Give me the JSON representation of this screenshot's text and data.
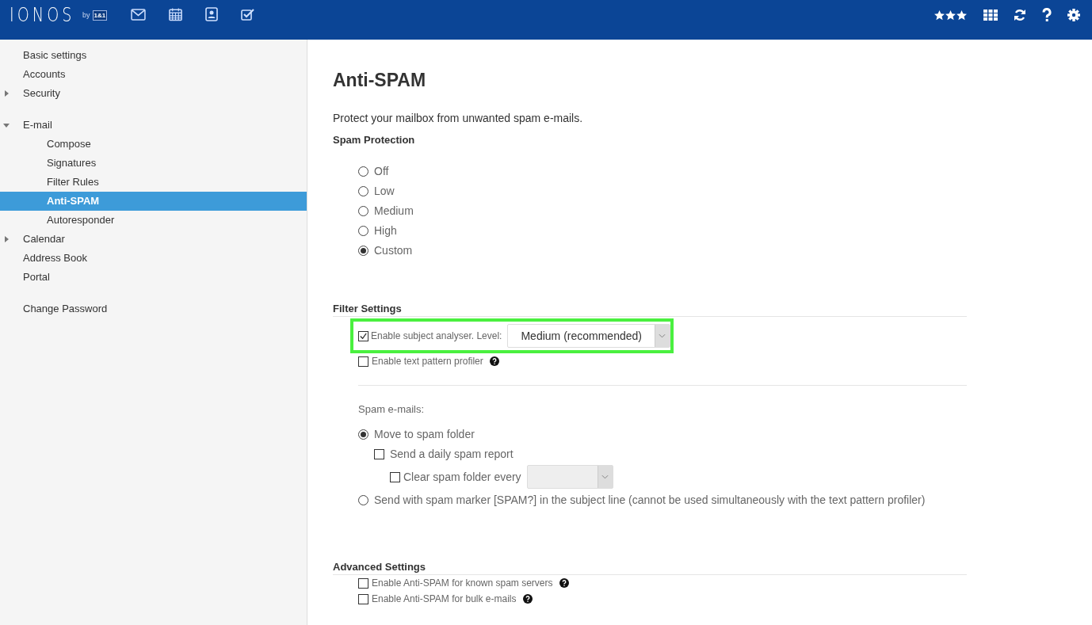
{
  "header": {
    "logo": "IONOS",
    "logo_by": "by",
    "logo_badge": "1&1"
  },
  "sidebar": {
    "groups": [
      [
        {
          "label": "Basic settings",
          "selected": false
        },
        {
          "label": "Accounts",
          "selected": false
        },
        {
          "label": "Security",
          "selected": false,
          "expanded": false
        }
      ],
      [
        {
          "label": "E-mail",
          "selected": false,
          "expanded": true,
          "children": [
            {
              "label": "Compose",
              "selected": false
            },
            {
              "label": "Signatures",
              "selected": false
            },
            {
              "label": "Filter Rules",
              "selected": false
            },
            {
              "label": "Anti-SPAM",
              "selected": true
            },
            {
              "label": "Autoresponder",
              "selected": false
            }
          ]
        },
        {
          "label": "Calendar",
          "selected": false,
          "expanded": false
        },
        {
          "label": "Address Book",
          "selected": false
        },
        {
          "label": "Portal",
          "selected": false
        }
      ],
      [
        {
          "label": "Change Password",
          "selected": false
        }
      ]
    ]
  },
  "page": {
    "title": "Anti-SPAM",
    "intro": "Protect your mailbox from unwanted spam e-mails.",
    "protection": {
      "heading": "Spam Protection",
      "options": [
        {
          "label": "Off",
          "selected": false
        },
        {
          "label": "Low",
          "selected": false
        },
        {
          "label": "Medium",
          "selected": false
        },
        {
          "label": "High",
          "selected": false
        },
        {
          "label": "Custom",
          "selected": true
        }
      ]
    },
    "filter": {
      "heading": "Filter Settings",
      "subject_analyser": {
        "label": "Enable subject analyser. Level:",
        "checked": true,
        "value": "Medium (recommended)",
        "highlighted": true
      },
      "text_pattern": {
        "label": "Enable text pattern profiler",
        "checked": false
      },
      "spam_heading": "Spam e-mails:",
      "move": {
        "label": "Move to spam folder",
        "selected": true
      },
      "daily_report": {
        "label": "Send a daily spam report",
        "checked": false
      },
      "clear_folder": {
        "label": "Clear spam folder every",
        "checked": false,
        "disabled": true
      },
      "marker": {
        "label": "Send with spam marker [SPAM?] in the subject line (cannot be used simultaneously with the text pattern profiler)",
        "selected": false
      }
    },
    "advanced": {
      "heading": "Advanced Settings",
      "options": [
        {
          "label": "Enable Anti-SPAM for known spam servers",
          "checked": false
        },
        {
          "label": "Enable Anti-SPAM for bulk e-mails",
          "checked": false
        }
      ]
    }
  }
}
